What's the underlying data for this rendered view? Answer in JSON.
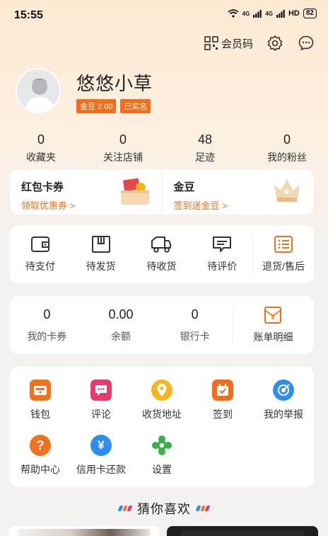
{
  "status": {
    "time": "15:55",
    "signal1": "4G",
    "signal2": "4G",
    "hd": "HD",
    "battery": "82"
  },
  "header": {
    "member_code": "会员码"
  },
  "profile": {
    "name": "悠悠小草",
    "badges": [
      "金豆 2.00",
      "已实名"
    ]
  },
  "stats": [
    {
      "num": "0",
      "label": "收藏夹"
    },
    {
      "num": "0",
      "label": "关注店铺"
    },
    {
      "num": "48",
      "label": "足迹"
    },
    {
      "num": "0",
      "label": "我的粉丝"
    }
  ],
  "promos": {
    "left": {
      "title": "红包卡券",
      "sub": "领取优惠券 >"
    },
    "right": {
      "title": "金豆",
      "sub": "签到送金豆 >"
    }
  },
  "orders": [
    {
      "label": "待支付",
      "icon": "wallet-icon"
    },
    {
      "label": "待发货",
      "icon": "package-icon"
    },
    {
      "label": "待收货",
      "icon": "truck-icon"
    },
    {
      "label": "待评价",
      "icon": "comment-icon"
    },
    {
      "label": "退货/售后",
      "icon": "return-icon"
    }
  ],
  "wallet": [
    {
      "num": "0",
      "label": "我的卡券"
    },
    {
      "num": "0.00",
      "label": "余额"
    },
    {
      "num": "0",
      "label": "银行卡"
    }
  ],
  "bill": {
    "label": "账单明细",
    "glyph": "¥"
  },
  "services": [
    {
      "label": "钱包",
      "color": "#f0721f"
    },
    {
      "label": "评论",
      "color": "#e8386e"
    },
    {
      "label": "收货地址",
      "color": "#f7b51c"
    },
    {
      "label": "签到",
      "color": "#f46d1a"
    },
    {
      "label": "我的举报",
      "color": "#2e8ef0"
    },
    {
      "label": "帮助中心",
      "color": "#f0721f"
    },
    {
      "label": "信用卡还款",
      "color": "#2e8ef0"
    },
    {
      "label": "设置",
      "color": "#3bb04a"
    }
  ],
  "service_glyphs": {
    "help": "?",
    "credit": "¥"
  },
  "guess": {
    "title": "猜你喜欢"
  },
  "colors": {
    "accent": "#f46d1a"
  }
}
